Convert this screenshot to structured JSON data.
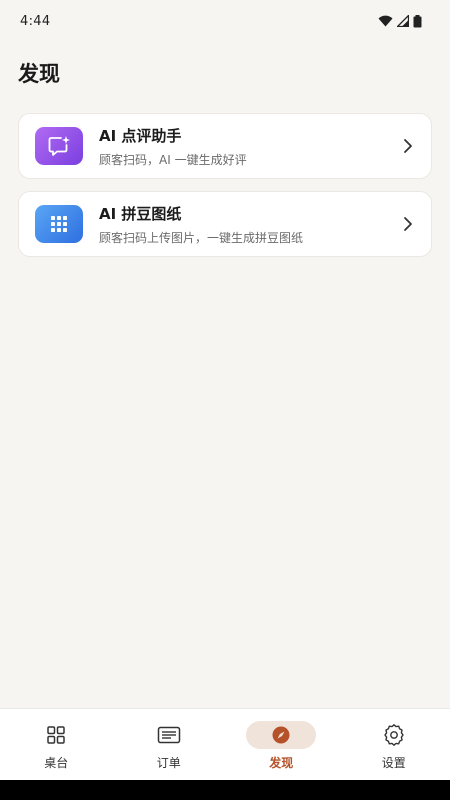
{
  "status_bar": {
    "time": "4:44",
    "icons": [
      "wifi-icon",
      "signal-icon",
      "battery-icon"
    ]
  },
  "page": {
    "title": "发现"
  },
  "cards": [
    {
      "title": "AI 点评助手",
      "description": "顾客扫码，AI 一键生成好评",
      "icon": "chat-sparkle-icon",
      "icon_color": "#8e4fe8"
    },
    {
      "title": "AI 拼豆图纸",
      "description": "顾客扫码上传图片，一键生成拼豆图纸",
      "icon": "grid-dots-icon",
      "icon_color": "#3d86ec"
    }
  ],
  "bottom_nav": {
    "items": [
      {
        "label": "桌台",
        "icon": "grid-icon",
        "active": false
      },
      {
        "label": "订单",
        "icon": "list-icon",
        "active": false
      },
      {
        "label": "发现",
        "icon": "compass-icon",
        "active": true
      },
      {
        "label": "设置",
        "icon": "gear-icon",
        "active": false
      }
    ],
    "active_color": "#b5522a"
  }
}
